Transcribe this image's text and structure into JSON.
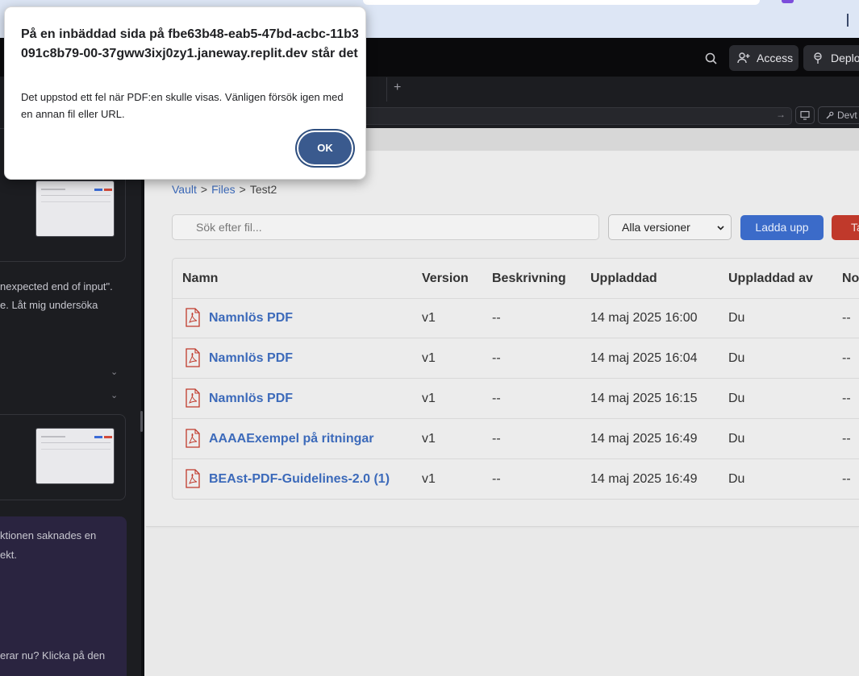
{
  "dialog": {
    "title": "På en inbäddad sida på fbe63b48-eab5-47bd-acbc-11b3091c8b79-00-37gww3ixj0zy1.janeway.replit.dev står det",
    "message": "Det uppstod ett fel när PDF:en skulle visas. Vänligen försök igen med en annan fil eller URL.",
    "ok_label": "OK"
  },
  "replit_header": {
    "access_label": "Access",
    "deploy_label": "Deplo",
    "devtools_label": "Devt"
  },
  "agent_pane": {
    "line1": "nexpected end of input\".",
    "line2": "e. Låt mig undersöka",
    "line3": "ktionen saknades en",
    "line4": "ekt.",
    "line5": "erar nu? Klicka på den"
  },
  "breadcrumb": {
    "items": [
      "Vault",
      "Files",
      "Test2"
    ],
    "separator": ">"
  },
  "toolbar": {
    "search_placeholder": "Sök efter fil...",
    "version_select": "Alla versioner",
    "upload_label": "Ladda upp",
    "danger_label": "Ta"
  },
  "table": {
    "headers": [
      "Namn",
      "Version",
      "Beskrivning",
      "Uppladdad",
      "Uppladdad av",
      "No"
    ],
    "rows": [
      {
        "name": "Namnlös PDF",
        "version": "v1",
        "description": "--",
        "uploaded": "14 maj 2025 16:00",
        "by": "Du",
        "notes": "--"
      },
      {
        "name": "Namnlös PDF",
        "version": "v1",
        "description": "--",
        "uploaded": "14 maj 2025 16:04",
        "by": "Du",
        "notes": "--"
      },
      {
        "name": "Namnlös PDF",
        "version": "v1",
        "description": "--",
        "uploaded": "14 maj 2025 16:15",
        "by": "Du",
        "notes": "--"
      },
      {
        "name": "AAAAExempel på ritningar",
        "version": "v1",
        "description": "--",
        "uploaded": "14 maj 2025 16:49",
        "by": "Du",
        "notes": "--"
      },
      {
        "name": "BEAst-PDF-Guidelines-2.0 (1)",
        "version": "v1",
        "description": "--",
        "uploaded": "14 maj 2025 16:49",
        "by": "Du",
        "notes": "--"
      }
    ]
  },
  "colors": {
    "accent": "#3b6bc9",
    "link": "#3c6aba",
    "danger": "#c0392b",
    "pdf_icon": "#c0392b",
    "ok_button": "#3a5a8e"
  }
}
